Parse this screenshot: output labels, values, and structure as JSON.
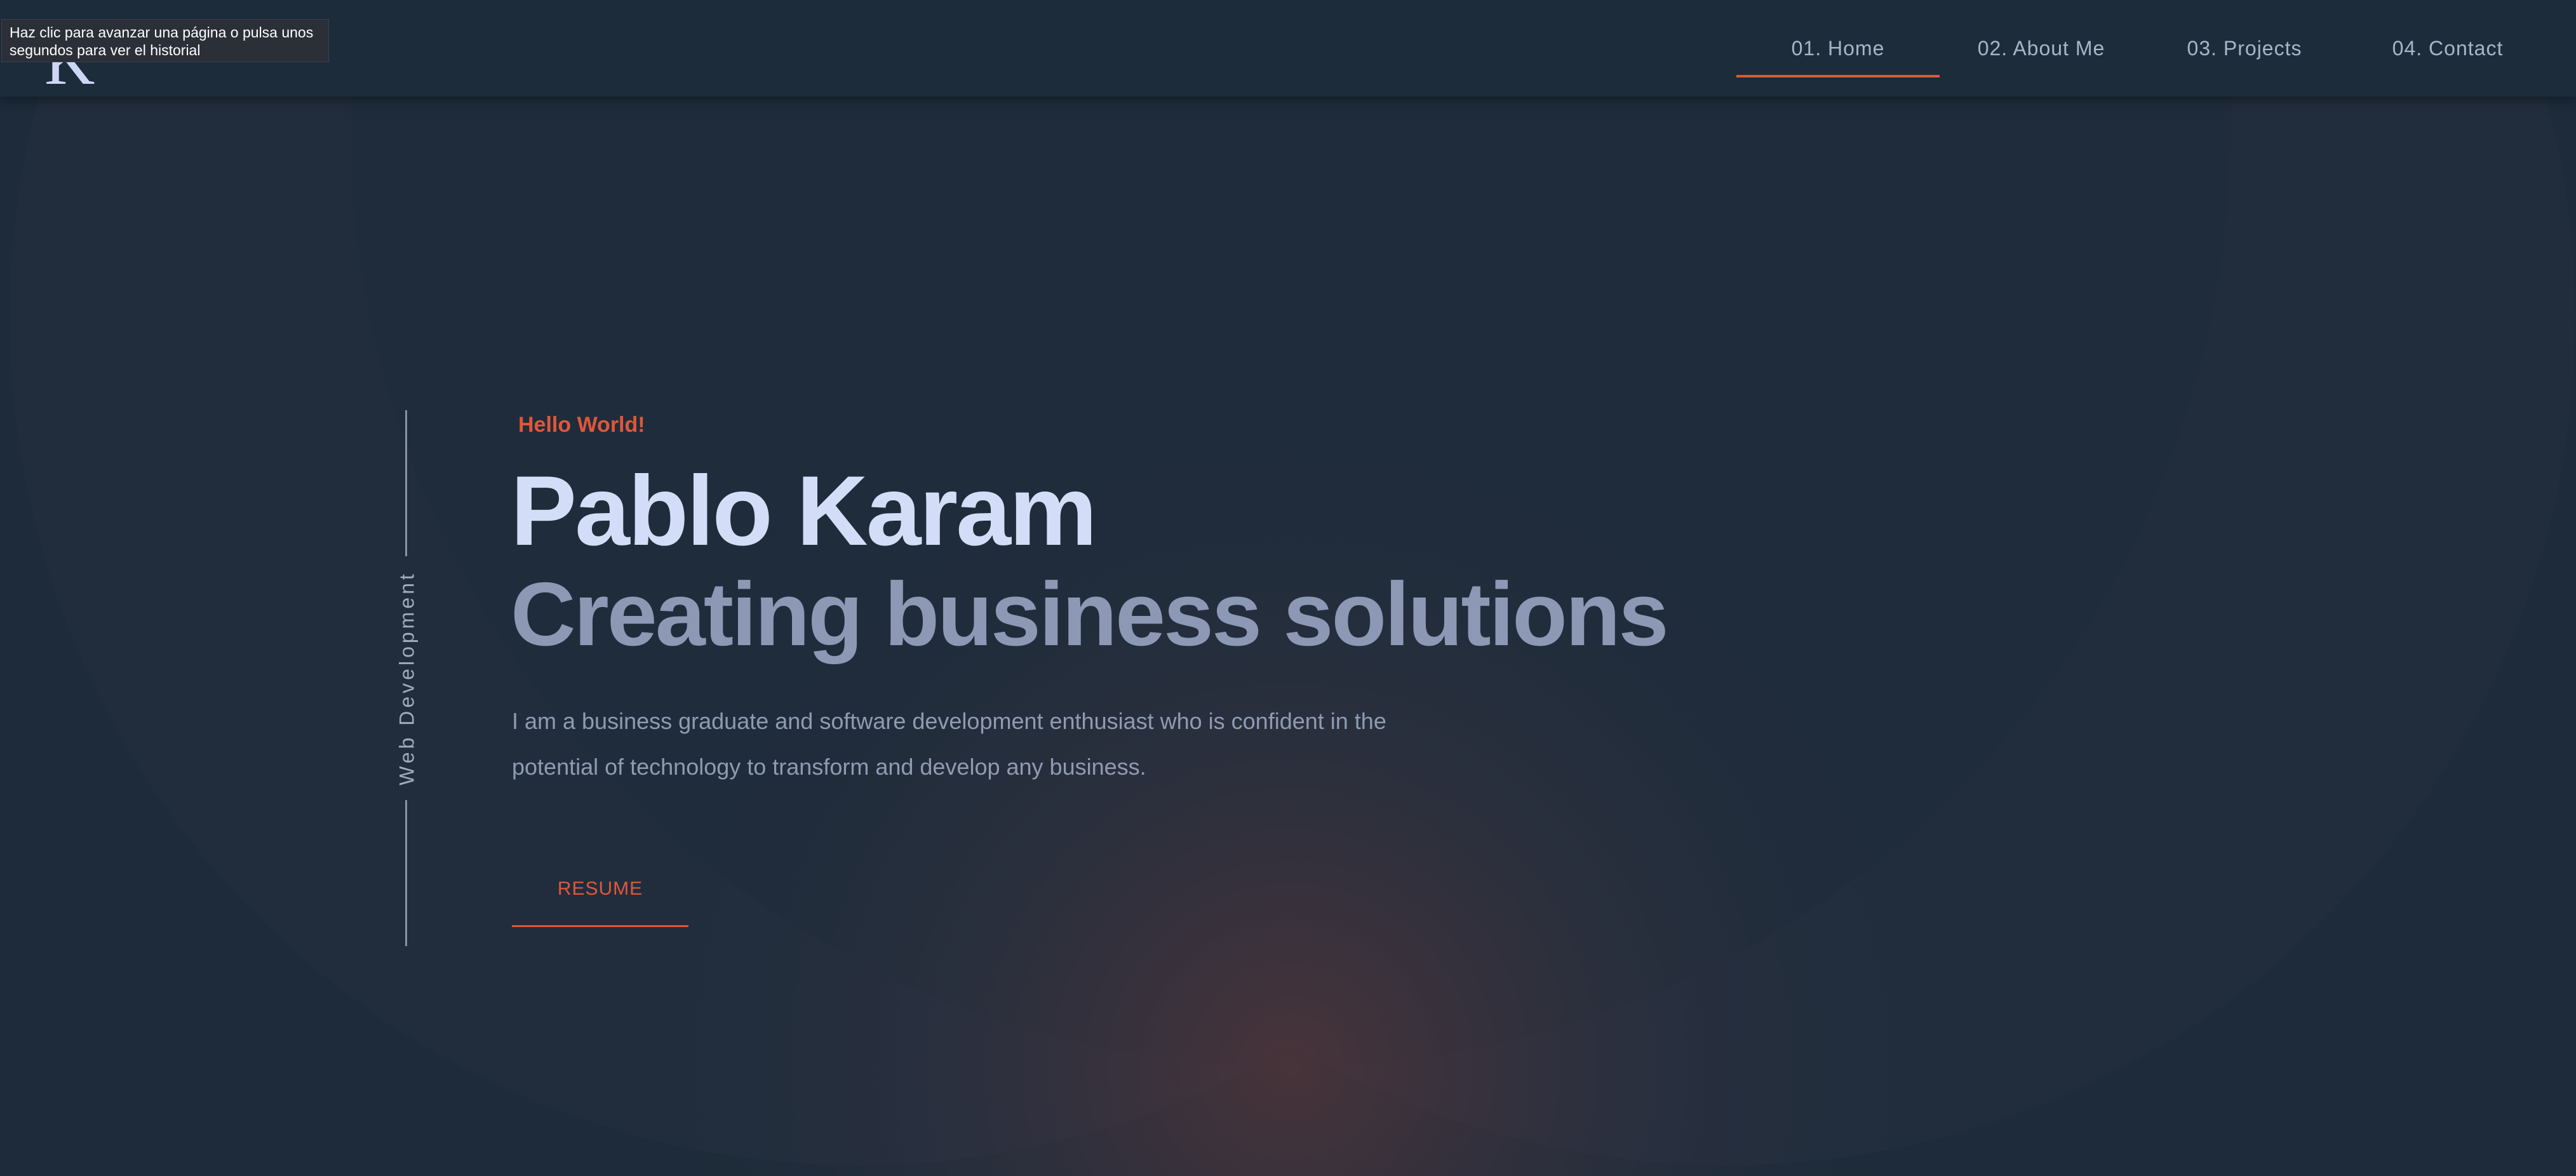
{
  "header": {
    "logo": "K",
    "nav": [
      {
        "label": "01. Home",
        "active": true
      },
      {
        "label": "02. About Me",
        "active": false
      },
      {
        "label": "03. Projects",
        "active": false
      },
      {
        "label": "04. Contact",
        "active": false
      }
    ]
  },
  "tooltip": {
    "text": "Haz clic para avanzar una página o pulsa unos segundos para ver el historial"
  },
  "hero": {
    "vertical_label": "Web Development",
    "greeting": "Hello World!",
    "name": "Pablo Karam",
    "tagline": "Creating business solutions",
    "description": "I am a business graduate and software development enthusiast who is confident in the potential of technology to transform and develop any business.",
    "button_label": "RESUME"
  },
  "colors": {
    "background": "#1c2c3b",
    "accent": "#e0573a",
    "name_text": "#d4ddf7",
    "tagline_text": "#8c98b4"
  }
}
